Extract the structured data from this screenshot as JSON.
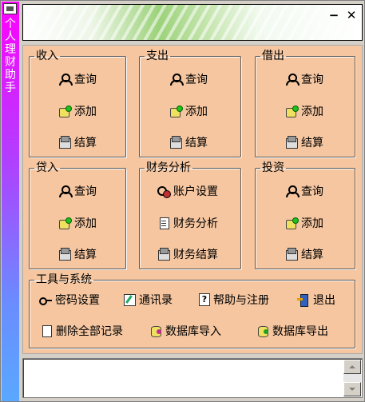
{
  "sidebar": {
    "title_chars": [
      "个",
      "人",
      "理",
      "财",
      "助",
      "手"
    ]
  },
  "window": {
    "minimize_glyph": "−",
    "close_glyph": "✕"
  },
  "groups": {
    "income": {
      "title": "收入",
      "query": "查询",
      "add": "添加",
      "settle": "结算"
    },
    "expense": {
      "title": "支出",
      "query": "查询",
      "add": "添加",
      "settle": "结算"
    },
    "lend": {
      "title": "借出",
      "query": "查询",
      "add": "添加",
      "settle": "结算"
    },
    "loan": {
      "title": "贷入",
      "query": "查询",
      "add": "添加",
      "settle": "结算"
    },
    "finance": {
      "title": "财务分析",
      "account_settings": "账户设置",
      "analysis": "财务分析",
      "settle": "财务结算"
    },
    "invest": {
      "title": "投资",
      "query": "查询",
      "add": "添加",
      "settle": "结算"
    },
    "tools": {
      "title": "工具与系统",
      "password": "密码设置",
      "contacts": "通讯录",
      "help": "帮助与注册",
      "exit": "退出",
      "delete_all": "删除全部记录",
      "db_import": "数据库导入",
      "db_export": "数据库导出"
    }
  },
  "memo": {
    "value": ""
  },
  "colors": {
    "panel_bg": "#f5c6a0",
    "sidebar_top": "#ff00ff",
    "sidebar_bottom": "#5aa8ff"
  }
}
